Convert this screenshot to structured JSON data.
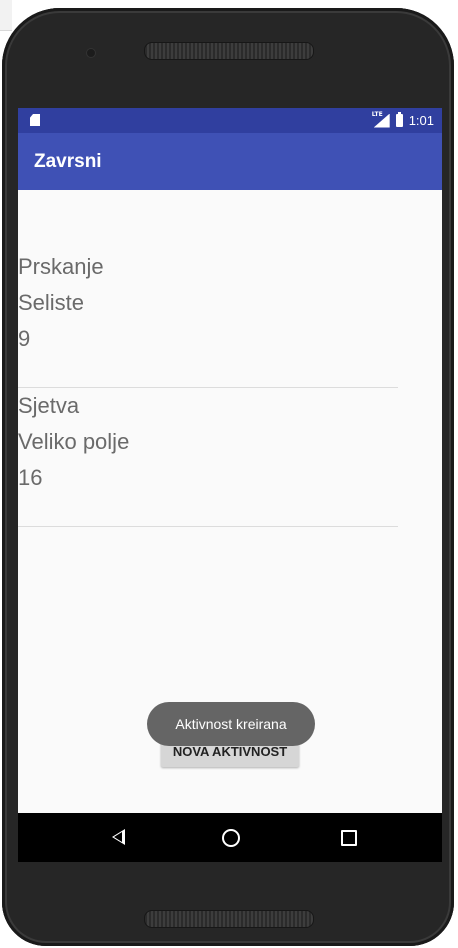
{
  "statusbar": {
    "time": "1:01",
    "network": "LTE"
  },
  "appbar": {
    "title": "Zavrsni"
  },
  "activities": [
    {
      "name": "Prskanje",
      "location": "Seliste",
      "value": "9"
    },
    {
      "name": "Sjetva",
      "location": "Veliko polje",
      "value": "16"
    }
  ],
  "button": {
    "label": "NOVA AKTIVNOST"
  },
  "toast": {
    "message": "Aktivnost kreirana"
  },
  "colors": {
    "statusbar": "#303f9f",
    "appbar": "#3f51b5",
    "toast": "#656565"
  },
  "icons": {
    "status_left": "sd-card-icon",
    "signal": "signal-icon",
    "battery": "battery-icon",
    "nav": [
      "back-icon",
      "home-icon",
      "recents-icon"
    ]
  }
}
